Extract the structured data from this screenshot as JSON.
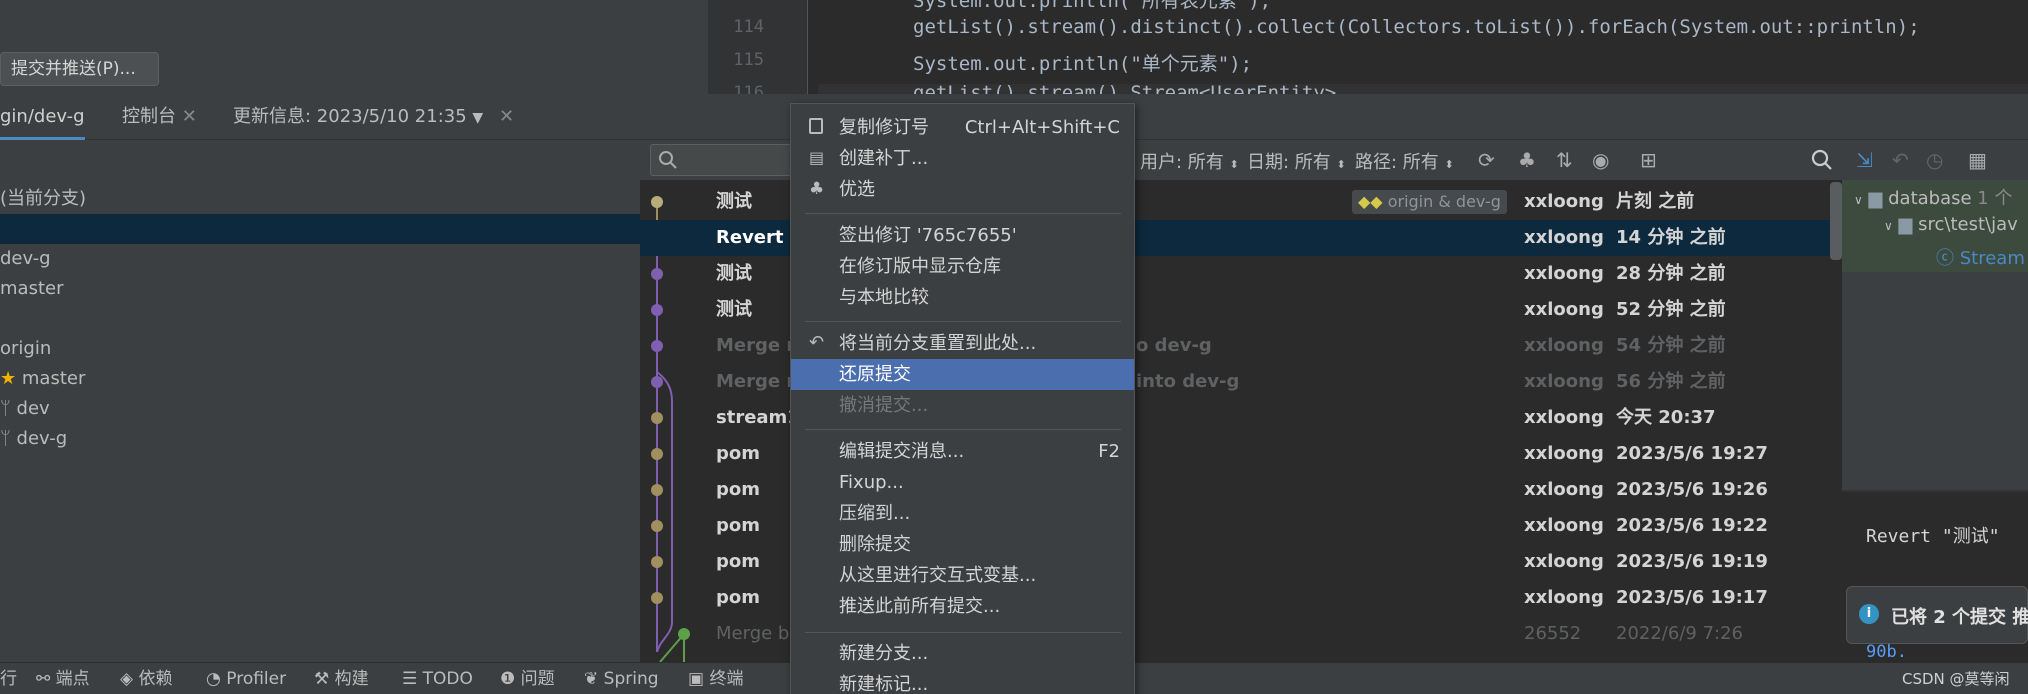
{
  "top": {
    "push_button": "提交并推送(P)..."
  },
  "editor": {
    "lines": [
      {
        "num": "",
        "code": "System.out.println(\"所有表元素\");"
      },
      {
        "num": "114",
        "code": "getList().stream().distinct().collect(Collectors.toList()).forEach(System.out::println);"
      },
      {
        "num": "115",
        "code": "System.out.println(\"单个元素\");"
      },
      {
        "num": "116",
        "code": "getList().stream() Stream<UserEntity>"
      }
    ]
  },
  "tabs": {
    "branch": "gin/dev-g",
    "console": "控制台",
    "update": "更新信息: 2023/5/10 21:35"
  },
  "branches": {
    "current": "(当前分支)",
    "local": [
      "dev-g",
      "master"
    ],
    "origin_label": "origin",
    "remote": [
      "master",
      "dev",
      "dev-g"
    ]
  },
  "filters": {
    "user": "用户: 所有",
    "date": "日期: 所有",
    "path": "路径: 所有"
  },
  "log": {
    "tag": "origin & dev-g",
    "rows": [
      {
        "msg": "测试",
        "author": "xxloong",
        "date": "片刻 之前",
        "selected": false,
        "dim": false
      },
      {
        "msg": "Revert \"",
        "author": "xxloong",
        "date": "14 分钟 之前",
        "selected": true,
        "dim": false
      },
      {
        "msg": "测试",
        "author": "xxloong",
        "date": "28 分钟 之前",
        "selected": false,
        "dim": false
      },
      {
        "msg": "测试",
        "author": "xxloong",
        "date": "52 分钟 之前",
        "selected": false,
        "dim": false
      },
      {
        "msg": "Merge r",
        "tail": "o dev-g",
        "author": "xxloong",
        "date": "54 分钟 之前",
        "selected": false,
        "dim": true
      },
      {
        "msg": "Merge r",
        "tail": "into dev-g",
        "author": "xxloong",
        "date": "56 分钟 之前",
        "selected": false,
        "dim": true
      },
      {
        "msg": "stream1",
        "author": "xxloong",
        "date": "今天 20:37",
        "selected": false,
        "dim": false
      },
      {
        "msg": "pom",
        "author": "xxloong",
        "date": "2023/5/6 19:27",
        "selected": false,
        "dim": false
      },
      {
        "msg": "pom",
        "author": "xxloong",
        "date": "2023/5/6 19:26",
        "selected": false,
        "dim": false
      },
      {
        "msg": "pom",
        "author": "xxloong",
        "date": "2023/5/6 19:22",
        "selected": false,
        "dim": false
      },
      {
        "msg": "pom",
        "author": "xxloong",
        "date": "2023/5/6 19:19",
        "selected": false,
        "dim": false
      },
      {
        "msg": "pom",
        "author": "xxloong",
        "date": "2023/5/6 19:17",
        "selected": false,
        "dim": false
      },
      {
        "msg": "Merge b",
        "author": "26552",
        "date": "2022/6/9 7:26",
        "selected": false,
        "dim": true
      }
    ]
  },
  "menu": {
    "items": [
      {
        "label": "复制修订号",
        "shortcut": "Ctrl+Alt+Shift+C",
        "icon": "copy-icon"
      },
      {
        "label": "创建补丁...",
        "shortcut": "",
        "icon": "patch-icon"
      },
      {
        "label": "优选",
        "shortcut": "",
        "icon": "cherry-pick-icon"
      },
      {
        "label": "签出修订 '765c7655'",
        "shortcut": ""
      },
      {
        "label": "在修订版中显示仓库",
        "shortcut": ""
      },
      {
        "label": "与本地比较",
        "shortcut": ""
      },
      {
        "label": "将当前分支重置到此处...",
        "shortcut": "",
        "icon": "undo-icon"
      },
      {
        "label": "还原提交",
        "shortcut": ""
      },
      {
        "label": "撤消提交...",
        "shortcut": ""
      },
      {
        "label": "编辑提交消息...",
        "shortcut": "F2"
      },
      {
        "label": "Fixup...",
        "shortcut": ""
      },
      {
        "label": "压缩到...",
        "shortcut": ""
      },
      {
        "label": "删除提交",
        "shortcut": ""
      },
      {
        "label": "从这里进行交互式变基...",
        "shortcut": ""
      },
      {
        "label": "推送此前所有提交...",
        "shortcut": ""
      },
      {
        "label": "新建分支...",
        "shortcut": ""
      },
      {
        "label": "新建标记...",
        "shortcut": ""
      }
    ]
  },
  "right_panel": {
    "tree": [
      "database",
      "1 个",
      "src\\test\\jav",
      "Stream"
    ],
    "detail": "Revert \"测试\"",
    "detail_tail": "90b.",
    "notification": "已将 2 个提交 推"
  },
  "bottom": {
    "items": [
      "行",
      "端点",
      "依赖",
      "Profiler",
      "构建",
      "TODO",
      "问题",
      "Spring",
      "终端"
    ],
    "watermark": "CSDN @莫等闲"
  }
}
